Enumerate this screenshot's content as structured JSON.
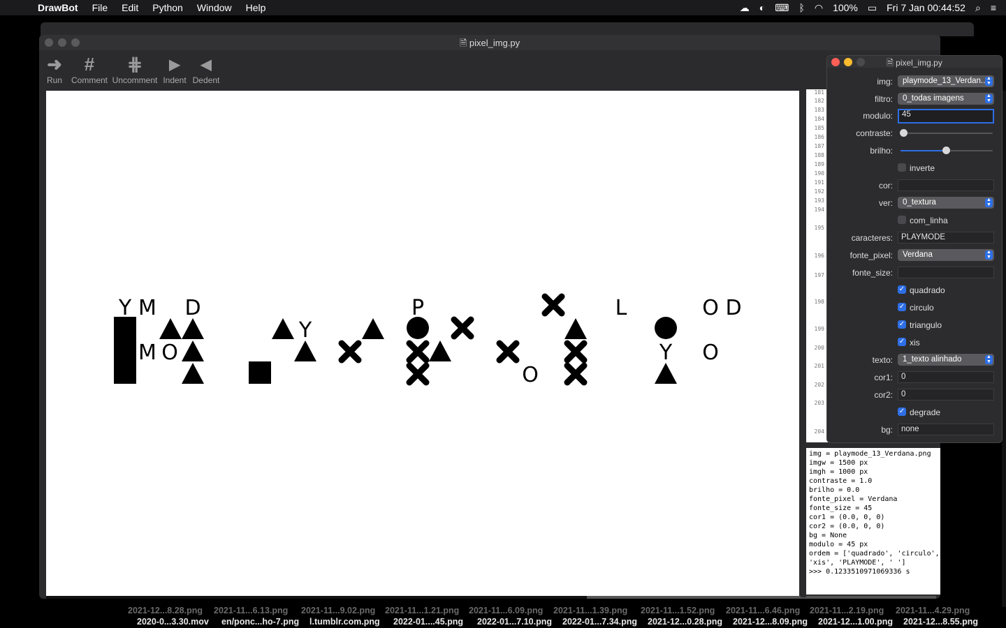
{
  "menubar": {
    "app": "DrawBot",
    "items": [
      "File",
      "Edit",
      "Python",
      "Window",
      "Help"
    ],
    "battery": "100%",
    "datetime": "Fri 7 Jan  00:44:52"
  },
  "desktop_files_row1": [
    "2021-12...8.28.png",
    "2021-11...6.13.png",
    "2021-11...9.02.png",
    "2021-11...1.21.png",
    "2021-11...6.09.png",
    "2021-11...1.39.png",
    "2021-11...1.52.png",
    "2021-11...6.46.png",
    "2021-11...2.19.png",
    "2021-11...4.29.png"
  ],
  "desktop_files_row2": [
    "2020-0...3.30.mov",
    "en/ponc...ho-7.png",
    "l.tumblr.com.png",
    "2022-01....45.png",
    "2022-01...7.10.png",
    "2022-01...7.34.png",
    "2021-12...0.28.png",
    "2021-12...8.09.png",
    "2021-12...1.00.png",
    "2021-12...8.55.png"
  ],
  "main_window": {
    "title": "pixel_img.py",
    "toolbar": [
      {
        "label": "Run",
        "icon": "run-icon"
      },
      {
        "label": "Comment",
        "icon": "comment-icon"
      },
      {
        "label": "Uncomment",
        "icon": "uncomment-icon"
      },
      {
        "label": "Indent",
        "icon": "indent-icon"
      },
      {
        "label": "Dedent",
        "icon": "dedent-icon"
      }
    ]
  },
  "canvas_chars": {
    "c1": "Y",
    "c2": "M",
    "c3": "D",
    "c4": "M",
    "c5": "O",
    "c6": "Y",
    "c7": "P",
    "c8": "L",
    "c9": "O",
    "c10": "D",
    "c11": "O",
    "c12": "Y",
    "c13": "O"
  },
  "line_numbers": [
    "181",
    "182",
    "183",
    "184",
    "185",
    "186",
    "187",
    "188",
    "189",
    "190",
    "191",
    "192",
    "193",
    "194",
    "195",
    "196",
    "197",
    "198",
    "199",
    "200",
    "201",
    "202",
    "203",
    "204"
  ],
  "console_text": "img = playmode_13_Verdana.png\nimgw = 1500 px\nimgh = 1000 px\ncontraste = 1.0\nbrilho = 0.0\nfonte_pixel = Verdana\nfonte_size = 45\ncor1 = (0.0, 0, 0)\ncor2 = (0.0, 0, 0)\nbg = None\nmodulo = 45 px\nordem = ['quadrado', 'circulo', 'triangulo',\n'xis', 'PLAYMODE', ' ']\n>>> 0.1233510971069336 s",
  "panel": {
    "title": "pixel_img.py",
    "img_label": "img:",
    "img_value": "playmode_13_Verdan...",
    "filtro_label": "filtro:",
    "filtro_value": "0_todas imagens",
    "modulo_label": "modulo:",
    "modulo_value": "45",
    "contraste_label": "contraste:",
    "contraste_level": 0.0,
    "brilho_label": "brilho:",
    "brilho_level": 0.5,
    "inverte_label": "inverte",
    "cor_label": "cor:",
    "cor_value": "",
    "ver_label": "ver:",
    "ver_value": "0_textura",
    "com_linha_label": "com_linha",
    "caracteres_label": "caracteres:",
    "caracteres_value": "PLAYMODE",
    "fonte_pixel_label": "fonte_pixel:",
    "fonte_pixel_value": "Verdana",
    "fonte_size_label": "fonte_size:",
    "fonte_size_value": "",
    "quadrado_label": "quadrado",
    "circulo_label": "circulo",
    "triangulo_label": "triangulo",
    "xis_label": "xis",
    "texto_label": "texto:",
    "texto_value": "1_texto alinhado",
    "cor1_label": "cor1:",
    "cor1_value": "0",
    "cor2_label": "cor2:",
    "cor2_value": "0",
    "degrade_label": "degrade",
    "bg_label": "bg:",
    "bg_value": "none"
  },
  "colors": {
    "accent": "#2e6fe6",
    "close": "#fe5f57",
    "minimize": "#febc2e",
    "zoom": "#4a4a4c"
  }
}
